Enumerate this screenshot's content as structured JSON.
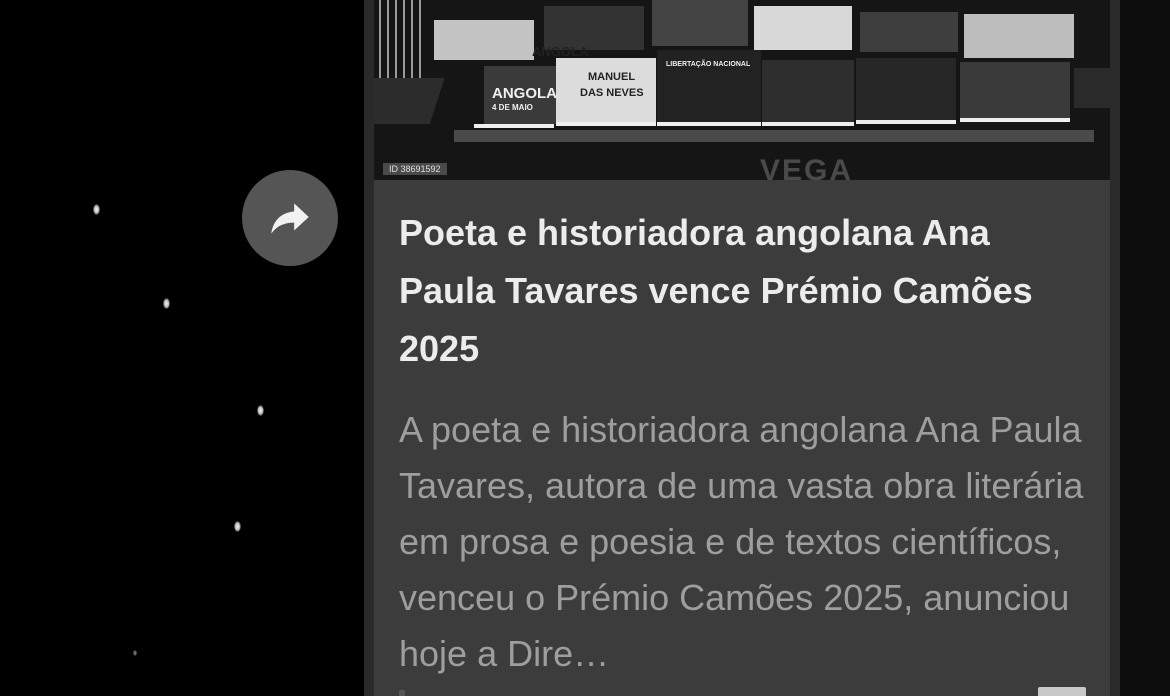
{
  "thumbnail": {
    "image_id_label": "ID 38691592",
    "watermark": "VEGA",
    "book_titles": [
      "ANGOLA",
      "MANUEL DAS NEVES",
      "LIBERTAÇÃO NACIONAL",
      "4 DE MAIO"
    ]
  },
  "share_button": {
    "icon": "share-arrow-icon"
  },
  "article": {
    "title": "Poeta e historiadora angolana Ana Paula Tavares vence Prémio Camões 2025",
    "description": "A poeta e historiadora angolana Ana Paula Tavares, autora de uma vasta obra literária em prosa e poesia e de textos científicos, venceu o Prémio Camões 2025, anunciou hoje a Dire…"
  },
  "colors": {
    "background": "#000000",
    "card": "#3c3c3c",
    "title_text": "#ececec",
    "description_text": "#9e9e9e",
    "share_button": "#555555"
  }
}
